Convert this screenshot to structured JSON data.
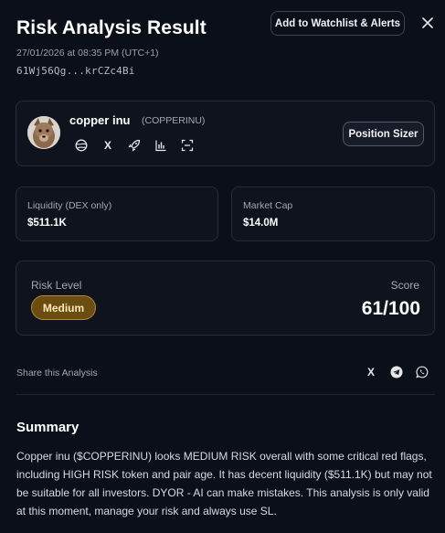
{
  "header": {
    "title": "Risk Analysis Result",
    "watchlist_label": "Add to Watchlist & Alerts",
    "timestamp": "27/01/2026 at 08:35 PM (UTC+1)",
    "address": "61Wj56Qg...krCZc4Bi"
  },
  "token": {
    "name": "copper inu",
    "symbol": "(COPPERINU)",
    "icons": [
      "globe-icon",
      "x-icon",
      "rocket-icon",
      "chart-bars-icon",
      "scan-icon"
    ],
    "x_glyph": "X",
    "position_sizer_label": "Position Sizer"
  },
  "stats": {
    "liquidity_label": "Liquidity (DEX only)",
    "liquidity_value": "$511.1K",
    "marketcap_label": "Market Cap",
    "marketcap_value": "$14.0M"
  },
  "risk": {
    "level_label": "Risk Level",
    "level_value": "Medium",
    "score_label": "Score",
    "score_value": "61/100",
    "badge_color": "#6b4d12"
  },
  "share": {
    "label": "Share this Analysis",
    "x_glyph": "X",
    "icons": [
      "x-icon",
      "telegram-icon",
      "whatsapp-icon"
    ]
  },
  "summary": {
    "title": "Summary",
    "text": "Copper inu ($COPPERINU) looks MEDIUM RISK overall with some critical red flags, including HIGH RISK token and pair age. It has decent liquidity ($511.1K) but may not be suitable for all investors. DYOR - AI can make mistakes. This analysis is only valid at this moment, manage your risk and always use SL."
  },
  "colors": {
    "background": "#0b0f1a",
    "card": "#0e131e",
    "border": "#252b38",
    "badge_border": "#b08a3a"
  }
}
